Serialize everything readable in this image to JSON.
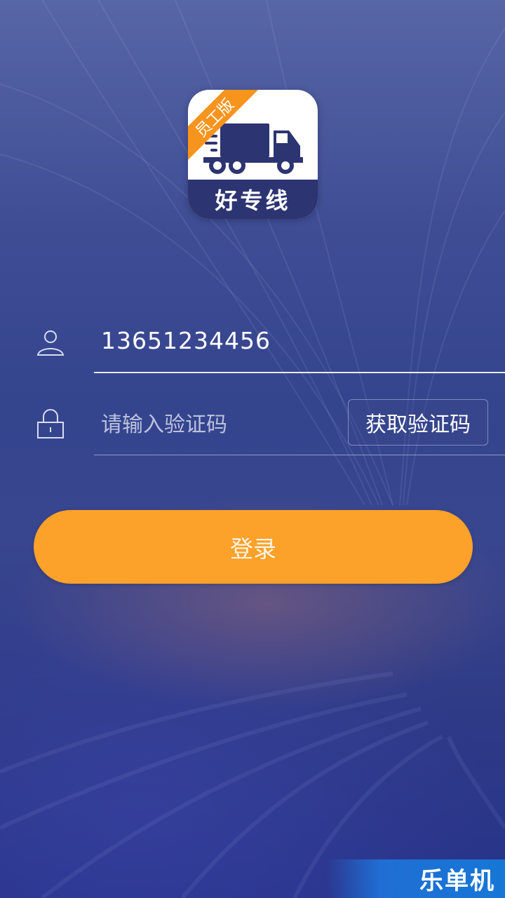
{
  "logo": {
    "ribbon_text": "员工版",
    "brand_name": "好专线",
    "icon": "delivery-truck-icon",
    "colors": {
      "ribbon": "#f7941e",
      "base": "#2d3472"
    }
  },
  "form": {
    "phone": {
      "icon": "user-icon",
      "value": "13651234456"
    },
    "code": {
      "icon": "lock-icon",
      "placeholder": "请输入验证码",
      "value": "",
      "get_code_label": "获取验证码"
    },
    "login_label": "登录"
  },
  "colors": {
    "accent": "#fca12a",
    "background": "#34448d"
  },
  "watermark": {
    "text": "乐单机"
  }
}
